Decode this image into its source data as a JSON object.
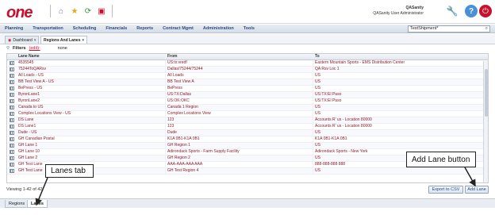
{
  "header": {
    "logo_text": "one",
    "user_name": "QASanity",
    "user_role": "QASanity User Administrator"
  },
  "icons": {
    "home": "home-icon",
    "favorites": "star-icon",
    "refresh": "refresh-icon",
    "screen": "screen-icon",
    "wrench": "wrench-icon",
    "help": "help-icon",
    "power": "power-icon"
  },
  "nav": {
    "items": [
      "Planning",
      "Transportation",
      "Scheduling",
      "Financials",
      "Reports",
      "Contract Mgmt",
      "Administration",
      "Tools"
    ],
    "search_value": "TestShipment*"
  },
  "page_tabs": [
    {
      "label": "Dashboard"
    },
    {
      "label": "Regions And Lanes"
    }
  ],
  "filters": {
    "label": "Filters",
    "edit_link": "(edit):",
    "value": "none"
  },
  "table": {
    "columns": [
      "Lane Name",
      "From",
      "To"
    ],
    "rows": [
      [
        "4535545",
        "US:tx:vredf",
        "Eastern Mountain Sports - EMS Distribution Center"
      ],
      [
        "75244ToQARsv",
        "Dallas/75244/75244",
        "QA Rsv Loc 1"
      ],
      [
        "All Loads - US",
        "All Loads",
        "US"
      ],
      [
        "BB Test View A - US",
        "BB Test View A",
        "US"
      ],
      [
        "BePress - US",
        "BePress",
        "US"
      ],
      [
        "ByronLane1",
        "US:TX:Dallas",
        "US:TX:El Paso"
      ],
      [
        "ByronLane2",
        "US:OK:OKC",
        "US:TX:El Paso"
      ],
      [
        "Canada to US",
        "Canada 1 Region",
        "US"
      ],
      [
        "Complex Locations View - US",
        "Complex Locations View",
        "US"
      ],
      [
        "DS Lane",
        "123",
        "Accounts R' us - Location 80000"
      ],
      [
        "DS Lane1",
        "123",
        "Accounts R' us - Location 80000"
      ],
      [
        "Dude - US",
        "Dude",
        "US"
      ],
      [
        "GH Canadian Postal",
        "K1A 0B1-K1A 0B1",
        "K1A 0B1-K1A 0B1"
      ],
      [
        "GH Lane 1",
        "GH Region 1",
        "US"
      ],
      [
        "GH Lane 10",
        "Adirondack Sports - Farm Supply Facility",
        "Adirondack Sports - New York"
      ],
      [
        "GH Lane 2",
        "GH Region 2",
        "US"
      ],
      [
        "GH Test Lane",
        "AAA-AAA-AAA AAA",
        "888-888-888 888"
      ],
      [
        "GH Test Lane",
        "GH Test Region 4",
        "US"
      ]
    ]
  },
  "footer": {
    "viewing": "Viewing 1-42 of 42",
    "export_label": "Export to CSV",
    "add_lane_label": "Add Lane"
  },
  "bottom_tabs": [
    "Regions",
    "Lanes"
  ],
  "callouts": {
    "lanes_tab": "Lanes tab",
    "add_lane_button": "Add Lane button"
  },
  "colors": {
    "brand": "#c8102e",
    "nav_text": "#2a4a7a",
    "link_text": "#8a1e2a"
  }
}
